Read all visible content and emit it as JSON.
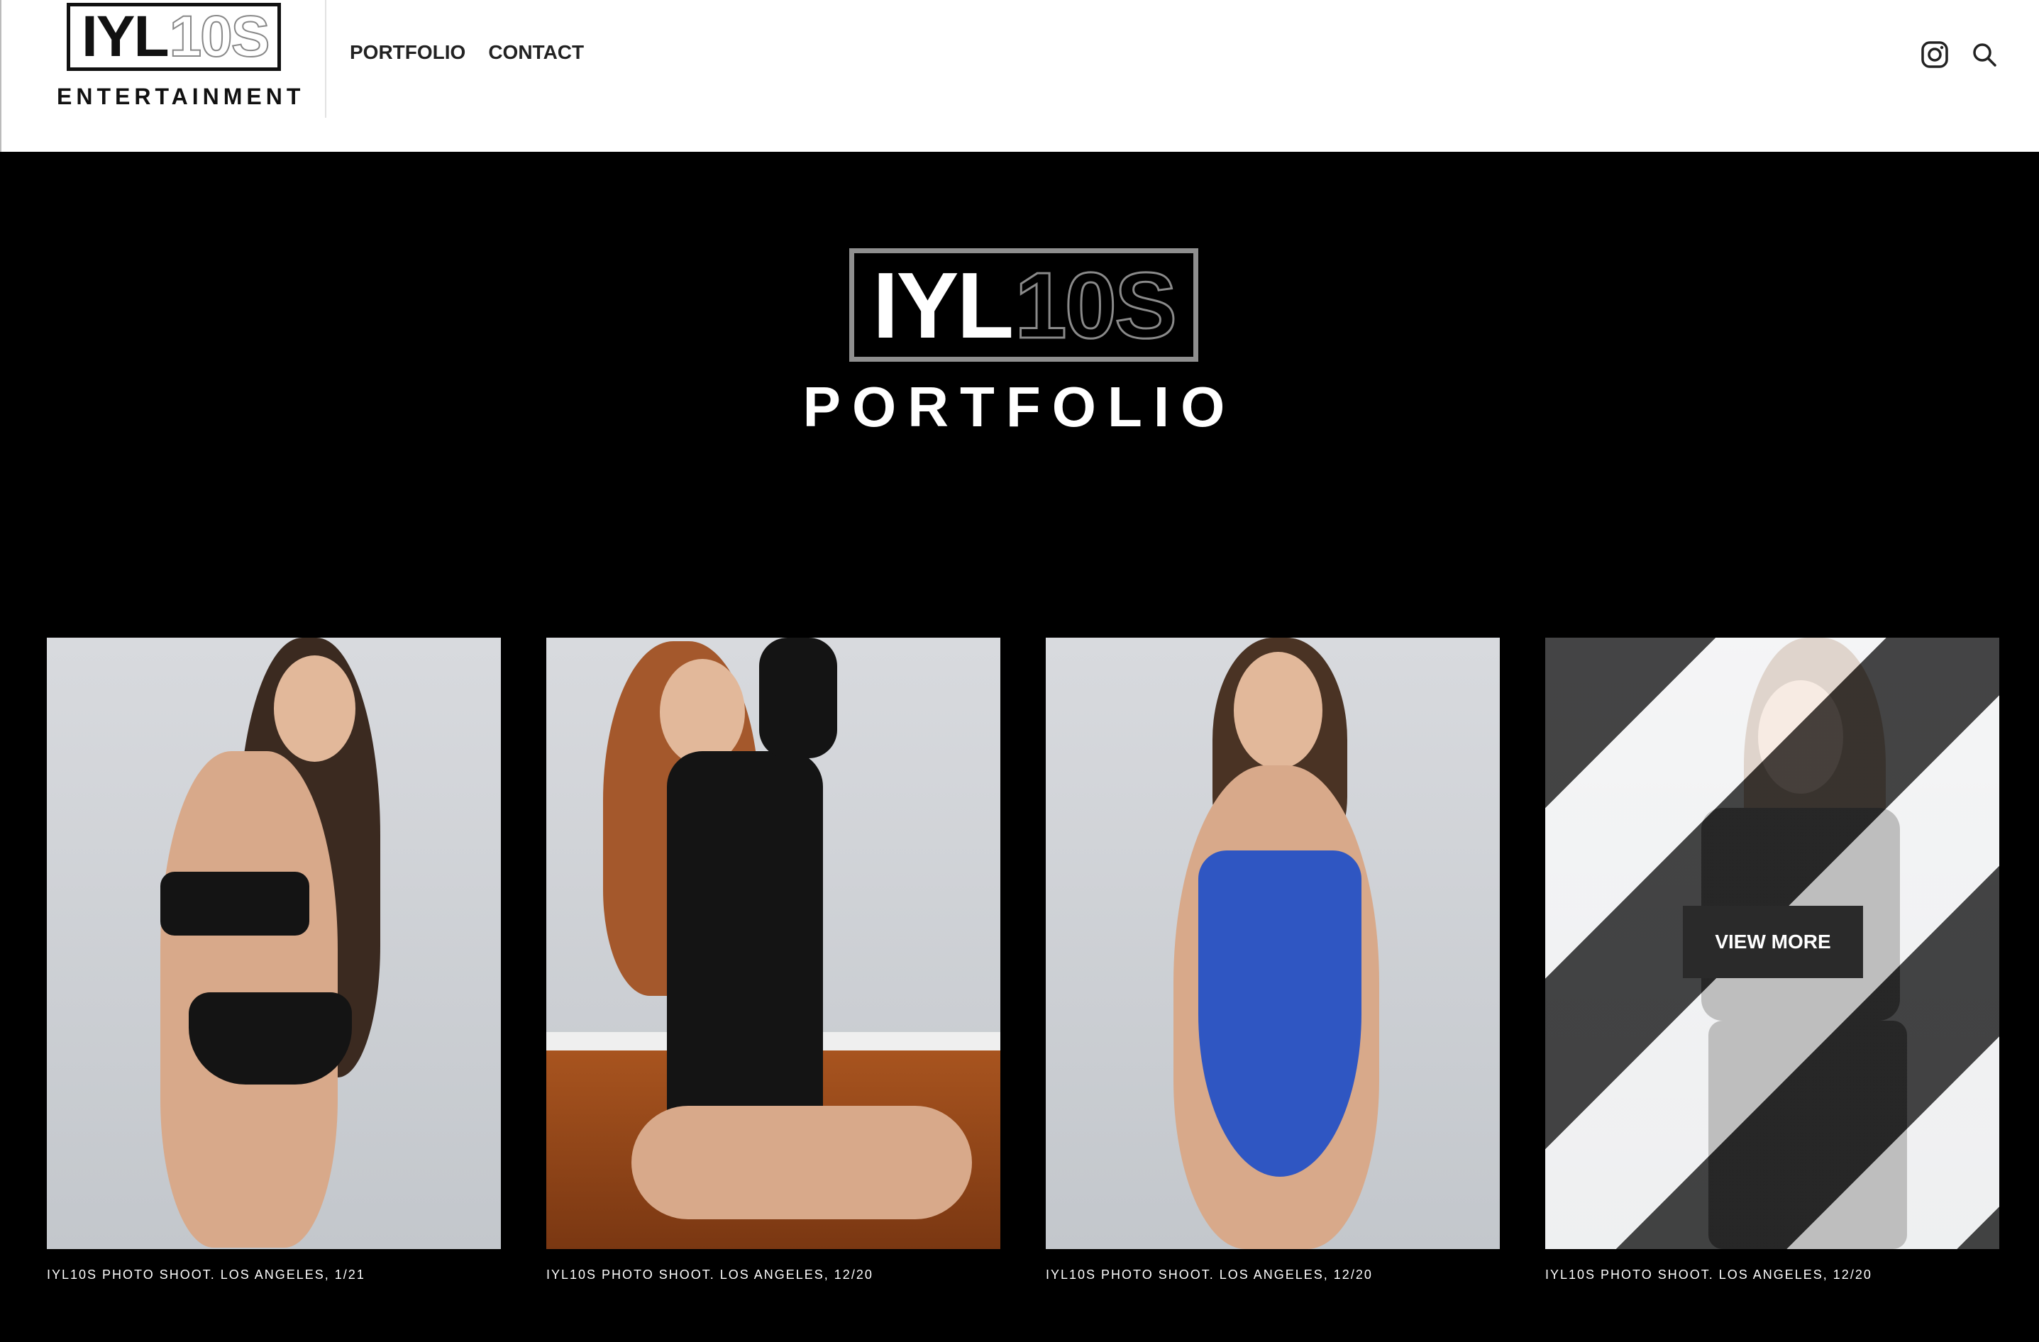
{
  "header": {
    "logo": {
      "mark_solid": "IYL",
      "mark_outline": "10S",
      "subtitle": "ENTERTAINMENT"
    },
    "nav": [
      "PORTFOLIO",
      "CONTACT"
    ],
    "icons": [
      "instagram-icon",
      "search-icon"
    ]
  },
  "hero": {
    "logo_solid": "IYL",
    "logo_outline": "10S",
    "title": "PORTFOLIO"
  },
  "gallery": {
    "items": [
      {
        "caption": "IYL10S PHOTO SHOOT. LOS ANGELES, 1/21"
      },
      {
        "caption": "IYL10S PHOTO SHOOT. LOS ANGELES, 12/20"
      },
      {
        "caption": "IYL10S PHOTO SHOOT. LOS ANGELES, 12/20"
      },
      {
        "caption": "IYL10S PHOTO SHOOT. LOS ANGELES, 12/20"
      }
    ],
    "view_more_label": "VIEW MORE"
  },
  "colors": {
    "background": "#000000",
    "header": "#ffffff",
    "accent_text": "#ffffff"
  }
}
